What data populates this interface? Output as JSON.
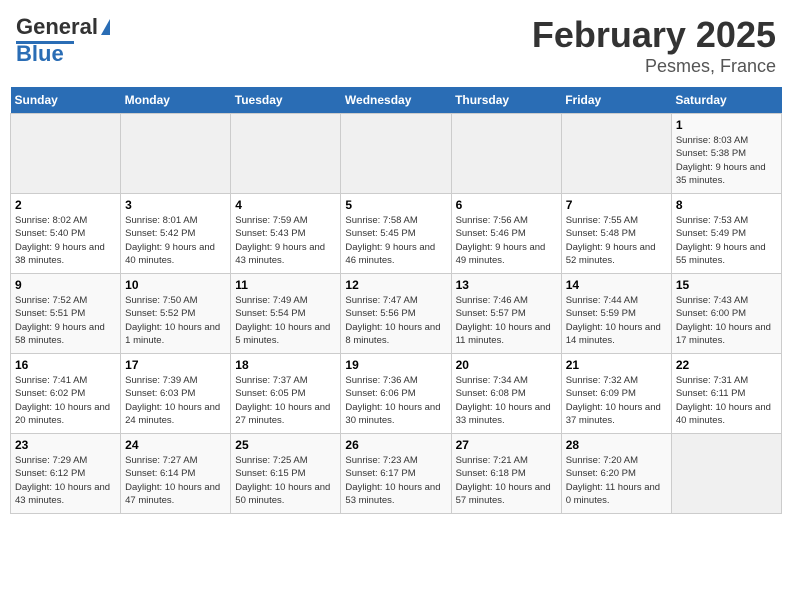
{
  "header": {
    "logo": {
      "line1": "General",
      "line2": "Blue"
    },
    "title": "February 2025",
    "subtitle": "Pesmes, France"
  },
  "days_of_week": [
    "Sunday",
    "Monday",
    "Tuesday",
    "Wednesday",
    "Thursday",
    "Friday",
    "Saturday"
  ],
  "weeks": [
    [
      {
        "day": "",
        "info": ""
      },
      {
        "day": "",
        "info": ""
      },
      {
        "day": "",
        "info": ""
      },
      {
        "day": "",
        "info": ""
      },
      {
        "day": "",
        "info": ""
      },
      {
        "day": "",
        "info": ""
      },
      {
        "day": "1",
        "info": "Sunrise: 8:03 AM\nSunset: 5:38 PM\nDaylight: 9 hours and 35 minutes."
      }
    ],
    [
      {
        "day": "2",
        "info": "Sunrise: 8:02 AM\nSunset: 5:40 PM\nDaylight: 9 hours and 38 minutes."
      },
      {
        "day": "3",
        "info": "Sunrise: 8:01 AM\nSunset: 5:42 PM\nDaylight: 9 hours and 40 minutes."
      },
      {
        "day": "4",
        "info": "Sunrise: 7:59 AM\nSunset: 5:43 PM\nDaylight: 9 hours and 43 minutes."
      },
      {
        "day": "5",
        "info": "Sunrise: 7:58 AM\nSunset: 5:45 PM\nDaylight: 9 hours and 46 minutes."
      },
      {
        "day": "6",
        "info": "Sunrise: 7:56 AM\nSunset: 5:46 PM\nDaylight: 9 hours and 49 minutes."
      },
      {
        "day": "7",
        "info": "Sunrise: 7:55 AM\nSunset: 5:48 PM\nDaylight: 9 hours and 52 minutes."
      },
      {
        "day": "8",
        "info": "Sunrise: 7:53 AM\nSunset: 5:49 PM\nDaylight: 9 hours and 55 minutes."
      }
    ],
    [
      {
        "day": "9",
        "info": "Sunrise: 7:52 AM\nSunset: 5:51 PM\nDaylight: 9 hours and 58 minutes."
      },
      {
        "day": "10",
        "info": "Sunrise: 7:50 AM\nSunset: 5:52 PM\nDaylight: 10 hours and 1 minute."
      },
      {
        "day": "11",
        "info": "Sunrise: 7:49 AM\nSunset: 5:54 PM\nDaylight: 10 hours and 5 minutes."
      },
      {
        "day": "12",
        "info": "Sunrise: 7:47 AM\nSunset: 5:56 PM\nDaylight: 10 hours and 8 minutes."
      },
      {
        "day": "13",
        "info": "Sunrise: 7:46 AM\nSunset: 5:57 PM\nDaylight: 10 hours and 11 minutes."
      },
      {
        "day": "14",
        "info": "Sunrise: 7:44 AM\nSunset: 5:59 PM\nDaylight: 10 hours and 14 minutes."
      },
      {
        "day": "15",
        "info": "Sunrise: 7:43 AM\nSunset: 6:00 PM\nDaylight: 10 hours and 17 minutes."
      }
    ],
    [
      {
        "day": "16",
        "info": "Sunrise: 7:41 AM\nSunset: 6:02 PM\nDaylight: 10 hours and 20 minutes."
      },
      {
        "day": "17",
        "info": "Sunrise: 7:39 AM\nSunset: 6:03 PM\nDaylight: 10 hours and 24 minutes."
      },
      {
        "day": "18",
        "info": "Sunrise: 7:37 AM\nSunset: 6:05 PM\nDaylight: 10 hours and 27 minutes."
      },
      {
        "day": "19",
        "info": "Sunrise: 7:36 AM\nSunset: 6:06 PM\nDaylight: 10 hours and 30 minutes."
      },
      {
        "day": "20",
        "info": "Sunrise: 7:34 AM\nSunset: 6:08 PM\nDaylight: 10 hours and 33 minutes."
      },
      {
        "day": "21",
        "info": "Sunrise: 7:32 AM\nSunset: 6:09 PM\nDaylight: 10 hours and 37 minutes."
      },
      {
        "day": "22",
        "info": "Sunrise: 7:31 AM\nSunset: 6:11 PM\nDaylight: 10 hours and 40 minutes."
      }
    ],
    [
      {
        "day": "23",
        "info": "Sunrise: 7:29 AM\nSunset: 6:12 PM\nDaylight: 10 hours and 43 minutes."
      },
      {
        "day": "24",
        "info": "Sunrise: 7:27 AM\nSunset: 6:14 PM\nDaylight: 10 hours and 47 minutes."
      },
      {
        "day": "25",
        "info": "Sunrise: 7:25 AM\nSunset: 6:15 PM\nDaylight: 10 hours and 50 minutes."
      },
      {
        "day": "26",
        "info": "Sunrise: 7:23 AM\nSunset: 6:17 PM\nDaylight: 10 hours and 53 minutes."
      },
      {
        "day": "27",
        "info": "Sunrise: 7:21 AM\nSunset: 6:18 PM\nDaylight: 10 hours and 57 minutes."
      },
      {
        "day": "28",
        "info": "Sunrise: 7:20 AM\nSunset: 6:20 PM\nDaylight: 11 hours and 0 minutes."
      },
      {
        "day": "",
        "info": ""
      }
    ]
  ]
}
